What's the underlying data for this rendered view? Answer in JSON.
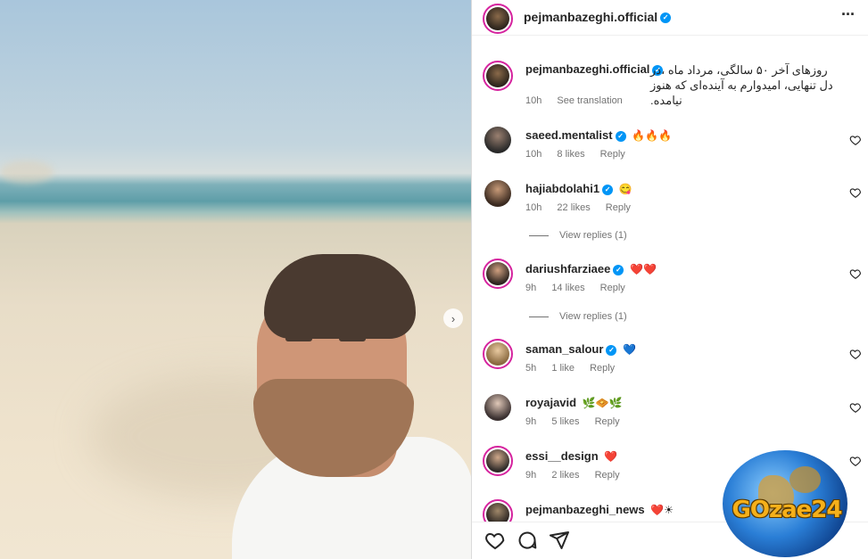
{
  "post": {
    "author": "pejmanbazeghi.official",
    "caption": "روزهای آخر ۵۰ سالگی، مرداد ماه ،در دل تنهایی، امیدوارم به آینده‌ای که هنوز نیامده.",
    "caption_time": "10h",
    "see_translation": "See translation"
  },
  "comments": [
    {
      "username": "saeed.mentalist",
      "verified": true,
      "text": "🔥🔥🔥",
      "time": "10h",
      "likes": "8 likes",
      "reply": "Reply"
    },
    {
      "username": "hajiabdolahi1",
      "verified": true,
      "text": "😋",
      "time": "10h",
      "likes": "22 likes",
      "reply": "Reply",
      "view_replies": "View replies (1)"
    },
    {
      "username": "dariushfarziaee",
      "verified": true,
      "text": "❤️❤️",
      "time": "9h",
      "likes": "14 likes",
      "reply": "Reply",
      "view_replies": "View replies (1)"
    },
    {
      "username": "saman_salour",
      "verified": true,
      "text": "💙",
      "time": "5h",
      "likes": "1 like",
      "reply": "Reply"
    },
    {
      "username": "royajavid",
      "verified": false,
      "text": "🌿🧇🌿",
      "time": "9h",
      "likes": "5 likes",
      "reply": "Reply"
    },
    {
      "username": "essi__design",
      "verified": false,
      "text": "❤️",
      "time": "9h",
      "likes": "2 likes",
      "reply": "Reply"
    },
    {
      "username": "pejmanbazeghi_news",
      "verified": false,
      "text": "❤️☀",
      "time": "",
      "likes": "",
      "reply": ""
    }
  ],
  "watermark": {
    "text": "GOzae24"
  },
  "icons": {
    "more": "more-options-icon",
    "like": "heart-icon",
    "comment": "comment-icon",
    "share": "share-icon",
    "next": "chevron-right-icon"
  },
  "colors": {
    "verified": "#0095f6",
    "story_ring": "#d6249f",
    "like_red": "#ed4956"
  }
}
